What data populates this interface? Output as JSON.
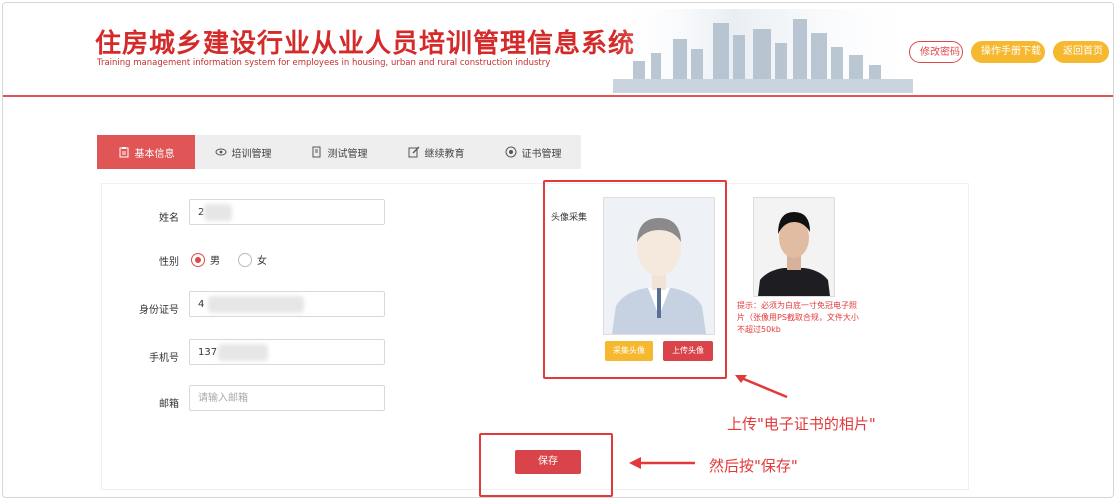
{
  "header": {
    "title_cn": "住房城乡建设行业从业人员培训管理信息系统",
    "title_en": "Training management information system for employees in housing, urban and rural construction industry",
    "buttons": {
      "change_password": "修改密码",
      "manual_download": "操作手册下载",
      "back_home": "返回首页"
    }
  },
  "tabs": [
    {
      "label": "基本信息",
      "icon": "clipboard-icon"
    },
    {
      "label": "培训管理",
      "icon": "eye-icon"
    },
    {
      "label": "测试管理",
      "icon": "document-icon"
    },
    {
      "label": "继续教育",
      "icon": "edit-icon"
    },
    {
      "label": "证书管理",
      "icon": "target-icon"
    }
  ],
  "form": {
    "name": {
      "label": "姓名",
      "value": "2"
    },
    "gender": {
      "label": "性别",
      "options": [
        "男",
        "女"
      ],
      "selected": "男"
    },
    "id_number": {
      "label": "身份证号",
      "value": "4"
    },
    "phone": {
      "label": "手机号",
      "value": "137"
    },
    "email": {
      "label": "邮箱",
      "placeholder": "请输入邮箱"
    }
  },
  "avatar": {
    "label": "头像采集",
    "capture_button": "采集头像",
    "upload_button": "上传头像",
    "hint": "提示：必须为白底一寸免冠电子照片（张像用PS截取合规，文件大小不超过50kb"
  },
  "save_button": "保存",
  "annotations": {
    "upload_note": "上传\"电子证书的相片\"",
    "save_note": "然后按\"保存\""
  },
  "colors": {
    "accent": "#e05555",
    "gold": "#f5b82e",
    "annotation": "#e23a3a"
  }
}
